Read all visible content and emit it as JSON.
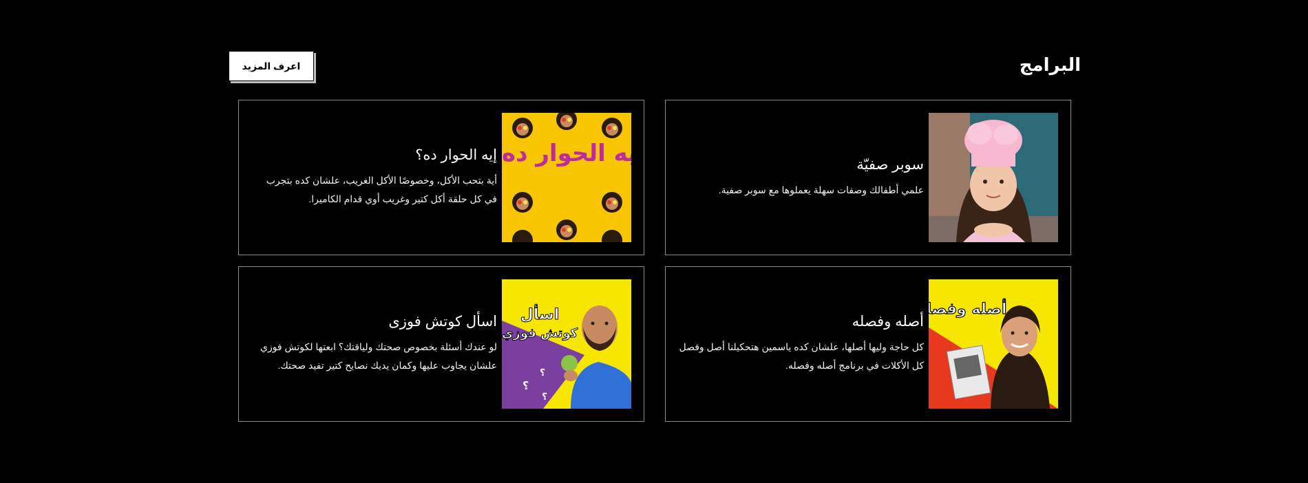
{
  "header": {
    "title": "البرامج",
    "more_label": "اعرف المزيد"
  },
  "programs": [
    {
      "title": "سوبر صفيّة",
      "description": "علمي أطفالك وصفات سهلة يعملوها مع سوبر صفية.",
      "thumb_icon": "chef-girl-image"
    },
    {
      "title": "إيه الحوار ده؟",
      "description": "أية بتحب الأكل، وخصوصًا الأكل الغريب، علشان كده بتجرب في كل حلقة أكل كتير وغريب أوي قدام الكاميرا.",
      "thumb_icon": "eh-el-hewar-poster",
      "thumb_text": "إيه الحوار ده؟"
    },
    {
      "title": "أصله وفصله",
      "description": "كل حاجة وليها أصلها، علشان كده ياسمين هتحكيلنا أصل وفصل كل الأكلات في برنامج أصله وفصله.",
      "thumb_icon": "asloh-w-fasloh-poster",
      "thumb_text": "أصله وفصله"
    },
    {
      "title": "اسأل كوتش فوزى",
      "description": "لو عندك أسئلة بخصوص صحتك ولياقتك؟ ابعتها لكوتش فوزي علشان يجاوب عليها وكمان يديك نصايح كتير تفيد صحتك.",
      "thumb_icon": "coach-fawzy-poster",
      "thumb_text_line1": "اسأل",
      "thumb_text_line2": "كوتش فوزي"
    }
  ],
  "colors": {
    "background": "#000000",
    "card_border": "#8a8a8a",
    "yellow": "#f7c600",
    "purple": "#7b3fa0",
    "red": "#e8391e"
  }
}
